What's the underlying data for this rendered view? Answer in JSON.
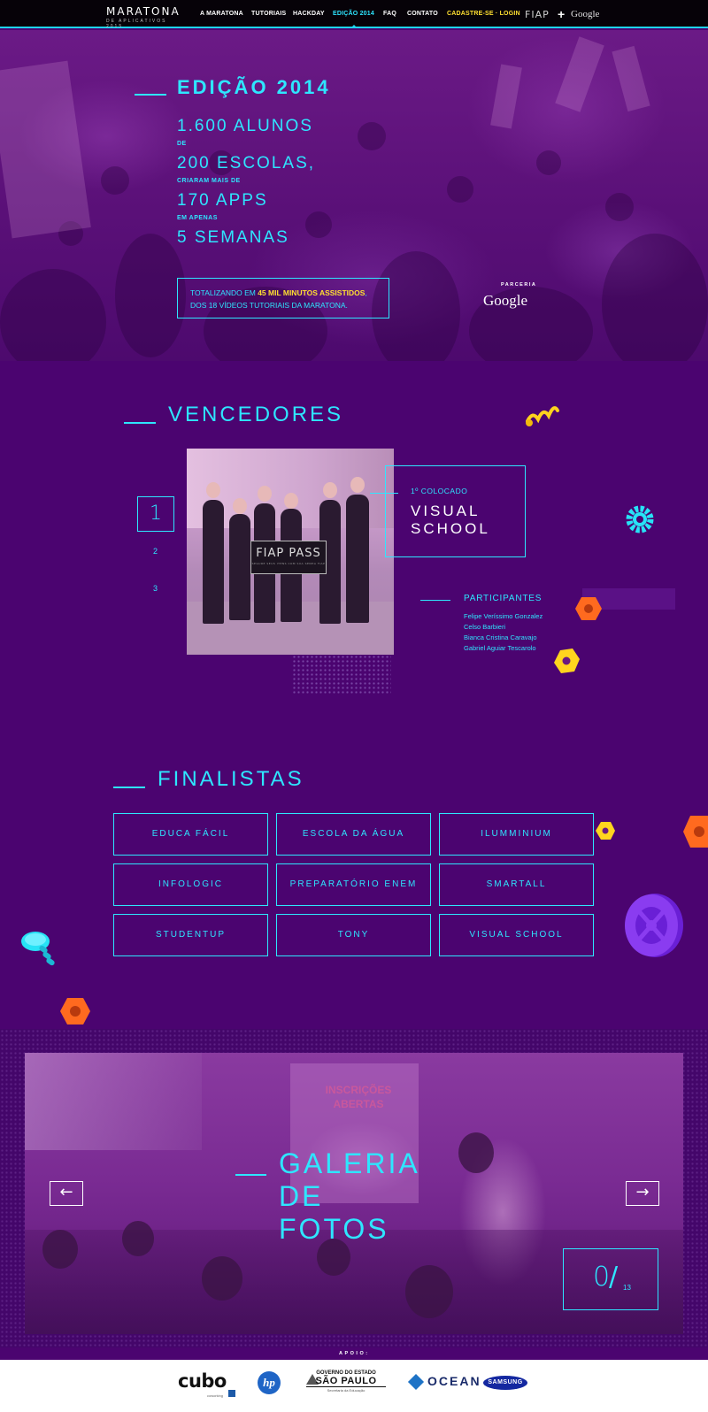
{
  "nav": {
    "logo": {
      "main": "MARATONA",
      "sub": "DE APLICATIVOS 2015"
    },
    "items": [
      {
        "label": "A MARATONA"
      },
      {
        "label": "TUTORIAIS"
      },
      {
        "label": "HACKDAY"
      },
      {
        "label": "EDIÇÃO 2014"
      },
      {
        "label": "FAQ"
      },
      {
        "label": "CONTATO"
      },
      {
        "label": "CADASTRE-SE · LOGIN"
      }
    ],
    "partners": {
      "fiap": "FIAP",
      "plus": "+",
      "google": "Google"
    }
  },
  "hero": {
    "title": "EDIÇÃO 2014",
    "stat1": "1.600 ALUNOS",
    "conn1": "DE",
    "stat2": "200 ESCOLAS,",
    "conn2": "CRIARAM MAIS DE",
    "stat3": "170 APPS",
    "conn3": "EM APENAS",
    "stat4": "5 SEMANAS",
    "totals_pre": "TOTALIZANDO EM ",
    "totals_highlight": "45 MIL MINUTOS ASSISTIDOS",
    "totals_post": ",",
    "totals_line2": "DOS 18 VÍDEOS TUTORIAIS DA MARATONA.",
    "parceria_label": "PARCERIA",
    "parceria_partner": "Google"
  },
  "vencedores": {
    "title": "VENCEDORES",
    "ranks": [
      "1",
      "2",
      "3"
    ],
    "photo_sign": "FIAP PASS",
    "photo_sign_sub": "SEGURE SEUS ITENS COM SUA SENHA FIAP",
    "place_label": "1º COLOCADO",
    "winner_name": "VISUAL SCHOOL",
    "participants_title": "PARTICIPANTES",
    "participants": [
      "Felipe Veríssimo Gonzalez",
      "Celso Barbieri",
      "Bianca Cristina Caravajo",
      "Gabriel Aguiar Tescarolo"
    ]
  },
  "finalistas": {
    "title": "FINALISTAS",
    "items": [
      "EDUCA FÁCIL",
      "ESCOLA DA ÁGUA",
      "ILUMMINIUM",
      "INFOLOGIC",
      "PREPARATÓRIO ENEM",
      "SMARTALL",
      "STUDENTUP",
      "TONY",
      "VISUAL SCHOOL"
    ]
  },
  "galeria": {
    "title_lines": [
      "GALERIA",
      "DE",
      "FOTOS"
    ],
    "screen_text": "INSCRIÇÕES ABERTAS",
    "prev_arrow": "←",
    "next_arrow": "→",
    "counter_current": "0",
    "counter_total": "13"
  },
  "apoio": {
    "label": "APOIO:",
    "sponsors": {
      "cubo": "cubo",
      "cubo_sub": "coworking",
      "hp": "hp",
      "sp_line1": "GOVERNO DO ESTADO",
      "sp_line2": "SÃO PAULO",
      "sp_line3": "Secretaria da Educação",
      "ocean": "OCEAN",
      "samsung": "SAMSUNG"
    }
  },
  "colors": {
    "accent": "#2ee6ff",
    "highlight": "#ffe031",
    "background": "#4b0470",
    "nav": "#060208"
  }
}
